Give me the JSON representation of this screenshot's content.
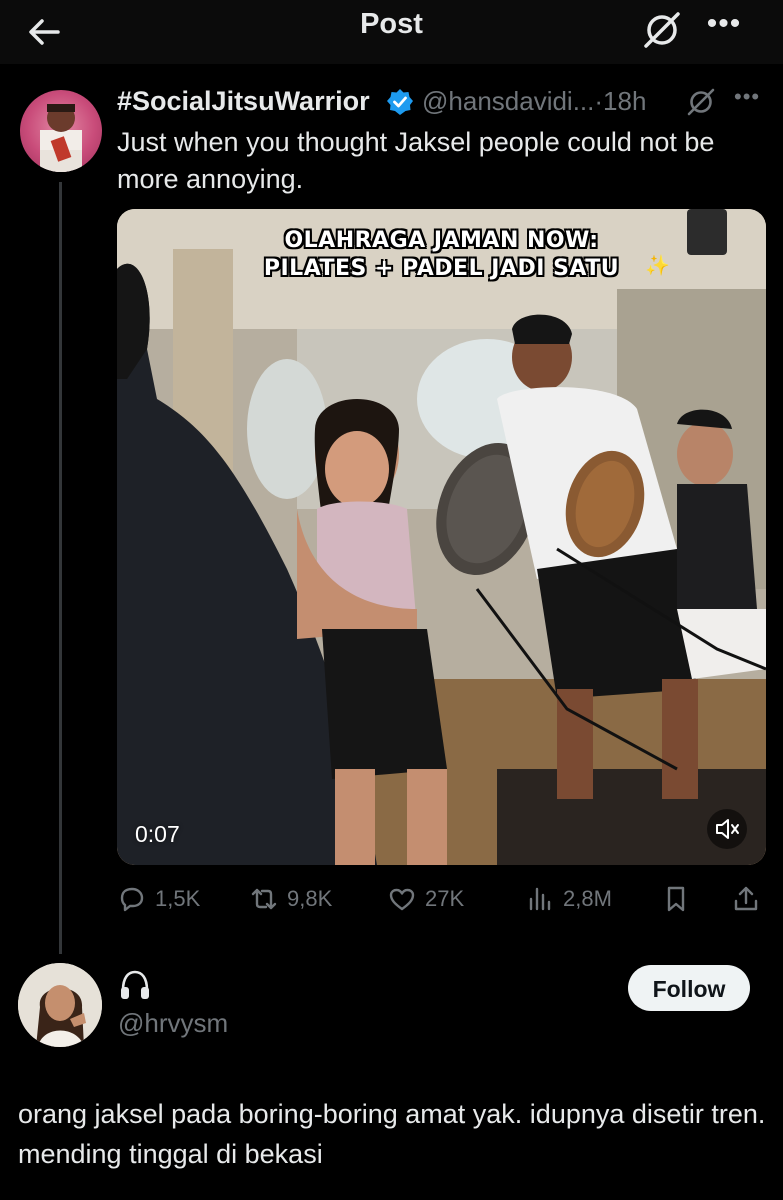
{
  "header": {
    "title": "Post"
  },
  "post": {
    "display_name": "#SocialJitsuWarrior",
    "handle_time": "@hansdavidi...·18h",
    "text": "Just when you thought Jaksel people could not be more annoying.",
    "media": {
      "caption_line1": "OLAHRAGA JAMAN NOW:",
      "caption_line2": "PILATES + PADEL JADI SATU",
      "duration": "0:07"
    },
    "stats": {
      "replies": "1,5K",
      "reposts": "9,8K",
      "likes": "27K",
      "views": "2,8M"
    }
  },
  "reply": {
    "handle": "@hrvysm",
    "follow_label": "Follow",
    "text": "orang jaksel pada boring-boring amat yak. idupnya disetir tren. mending tinggal di bekasi"
  },
  "colors": {
    "background": "#000000",
    "text_primary": "#e7e9ea",
    "text_secondary": "#71767b",
    "verified": "#1d9bf0",
    "follow_bg": "#eff3f4"
  },
  "icons": [
    "back-arrow-icon",
    "grok-icon",
    "more-icon",
    "verified-badge-icon",
    "reply-icon",
    "repost-icon",
    "like-icon",
    "views-icon",
    "bookmark-icon",
    "share-icon",
    "mute-icon",
    "headphones-icon"
  ]
}
